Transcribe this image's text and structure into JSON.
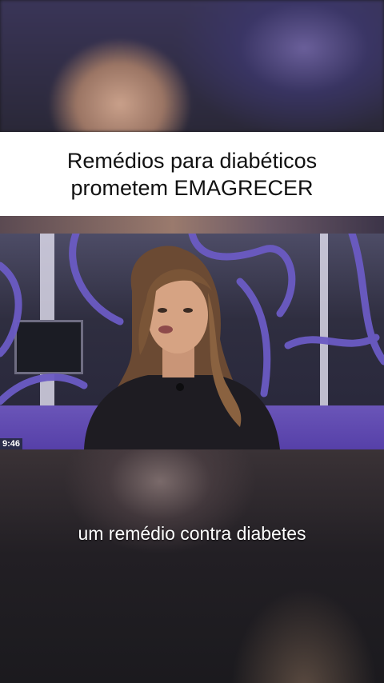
{
  "title": {
    "line1": "Remédios para diabéticos",
    "line2": "prometem EMAGRECER"
  },
  "video": {
    "timestamp": "9:46",
    "accent_color": "#6a55b8"
  },
  "subtitle": "um remédio contra diabetes"
}
